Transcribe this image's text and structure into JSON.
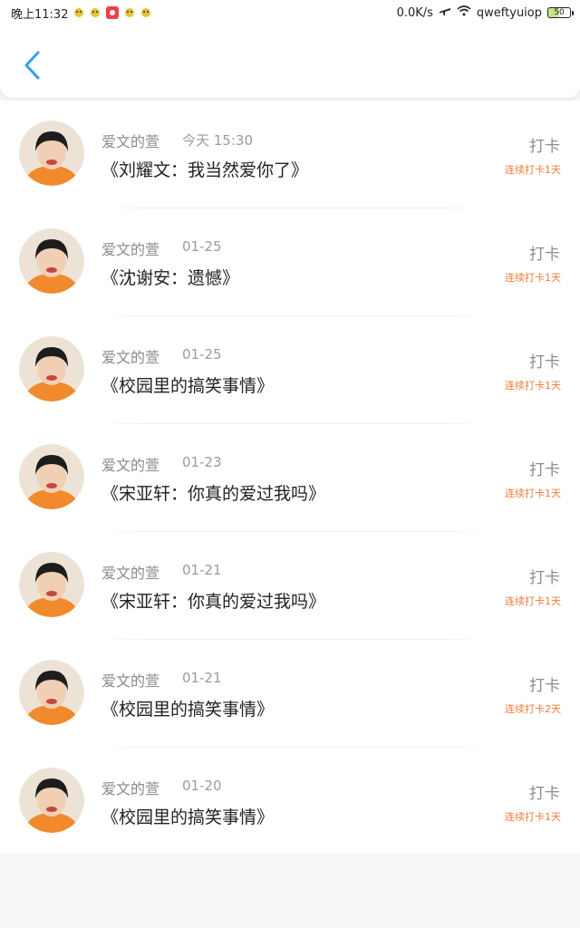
{
  "status_bar": {
    "time": "晚上11:32",
    "speed": "0.0K/s",
    "carrier": "qweftyuiop",
    "battery": "50"
  },
  "header": {
    "back_icon": "chevron-left-icon",
    "accent_color": "#2aa2f0"
  },
  "records": [
    {
      "author": "爱文的萱",
      "date": "今天 15:30",
      "title": "《刘耀文：我当然爱你了》",
      "checkin": "打卡",
      "streak": "连续打卡1天"
    },
    {
      "author": "爱文的萱",
      "date": "01-25",
      "title": "《沈谢安：遗憾》",
      "checkin": "打卡",
      "streak": "连续打卡1天"
    },
    {
      "author": "爱文的萱",
      "date": "01-25",
      "title": "《校园里的搞笑事情》",
      "checkin": "打卡",
      "streak": "连续打卡1天"
    },
    {
      "author": "爱文的萱",
      "date": "01-23",
      "title": "《宋亚轩：你真的爱过我吗》",
      "checkin": "打卡",
      "streak": "连续打卡1天"
    },
    {
      "author": "爱文的萱",
      "date": "01-21",
      "title": "《宋亚轩：你真的爱过我吗》",
      "checkin": "打卡",
      "streak": "连续打卡1天"
    },
    {
      "author": "爱文的萱",
      "date": "01-21",
      "title": "《校园里的搞笑事情》",
      "checkin": "打卡",
      "streak": "连续打卡2天"
    },
    {
      "author": "爱文的萱",
      "date": "01-20",
      "title": "《校园里的搞笑事情》",
      "checkin": "打卡",
      "streak": "连续打卡1天"
    }
  ],
  "colors": {
    "streak": "#f07c3b",
    "meta": "#9b9b9b",
    "title": "#222222"
  }
}
